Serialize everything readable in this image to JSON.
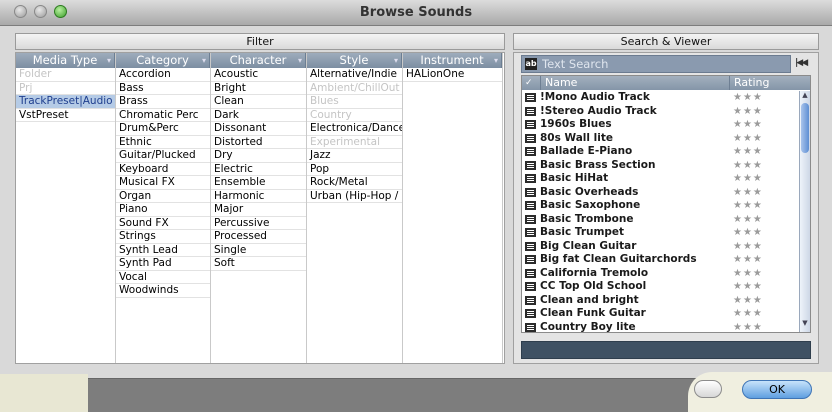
{
  "window": {
    "title": "Browse Sounds"
  },
  "filter": {
    "title": "Filter",
    "columns": [
      {
        "header": "Media Type",
        "items": [
          {
            "label": "Folder",
            "state": "dim"
          },
          {
            "label": "Prj",
            "state": "dim"
          },
          {
            "label": "TrackPreset|Audio",
            "state": "selected"
          },
          {
            "label": "VstPreset",
            "state": "normal"
          }
        ]
      },
      {
        "header": "Category",
        "items": [
          {
            "label": "Accordion"
          },
          {
            "label": "Bass"
          },
          {
            "label": "Brass"
          },
          {
            "label": "Chromatic Perc"
          },
          {
            "label": "Drum&Perc"
          },
          {
            "label": "Ethnic"
          },
          {
            "label": "Guitar/Plucked"
          },
          {
            "label": "Keyboard"
          },
          {
            "label": "Musical FX"
          },
          {
            "label": "Organ"
          },
          {
            "label": "Piano"
          },
          {
            "label": "Sound FX"
          },
          {
            "label": "Strings"
          },
          {
            "label": "Synth Lead"
          },
          {
            "label": "Synth Pad"
          },
          {
            "label": "Vocal"
          },
          {
            "label": "Woodwinds"
          }
        ]
      },
      {
        "header": "Character",
        "items": [
          {
            "label": "Acoustic"
          },
          {
            "label": "Bright"
          },
          {
            "label": "Clean"
          },
          {
            "label": "Dark"
          },
          {
            "label": "Dissonant"
          },
          {
            "label": "Distorted"
          },
          {
            "label": "Dry"
          },
          {
            "label": "Electric"
          },
          {
            "label": "Ensemble"
          },
          {
            "label": "Harmonic"
          },
          {
            "label": "Major"
          },
          {
            "label": "Percussive"
          },
          {
            "label": "Processed"
          },
          {
            "label": "Single"
          },
          {
            "label": "Soft"
          }
        ]
      },
      {
        "header": "Style",
        "items": [
          {
            "label": "Alternative/Indie",
            "state": "normal"
          },
          {
            "label": "Ambient/ChillOut",
            "state": "dim"
          },
          {
            "label": "Blues",
            "state": "dim"
          },
          {
            "label": "Country",
            "state": "dim"
          },
          {
            "label": "Electronica/Dance",
            "state": "normal"
          },
          {
            "label": "Experimental",
            "state": "dim"
          },
          {
            "label": "Jazz",
            "state": "normal"
          },
          {
            "label": "Pop",
            "state": "normal"
          },
          {
            "label": "Rock/Metal",
            "state": "normal"
          },
          {
            "label": "Urban (Hip-Hop /",
            "state": "normal"
          }
        ]
      },
      {
        "header": "Instrument",
        "items": [
          {
            "label": "HALionOne"
          }
        ]
      }
    ]
  },
  "search_viewer": {
    "title": "Search & Viewer",
    "search_placeholder": "Text Search",
    "search_icon_glyph": "ab",
    "skip_start_glyph": "|◀◀",
    "columns": {
      "check": "✓",
      "name": "Name",
      "rating": "Rating"
    },
    "rows": [
      {
        "name": "!Mono Audio Track",
        "rating": "★★★"
      },
      {
        "name": "!Stereo Audio Track",
        "rating": "★★★"
      },
      {
        "name": "1960s Blues",
        "rating": "★★★"
      },
      {
        "name": "80s Wall lite",
        "rating": "★★★"
      },
      {
        "name": "Ballade E-Piano",
        "rating": "★★★"
      },
      {
        "name": "Basic Brass Section",
        "rating": "★★★"
      },
      {
        "name": "Basic HiHat",
        "rating": "★★★"
      },
      {
        "name": "Basic Overheads",
        "rating": "★★★"
      },
      {
        "name": "Basic Saxophone",
        "rating": "★★★"
      },
      {
        "name": "Basic Trombone",
        "rating": "★★★"
      },
      {
        "name": "Basic Trumpet",
        "rating": "★★★"
      },
      {
        "name": "Big Clean Guitar",
        "rating": "★★★"
      },
      {
        "name": "Big fat Clean Guitarchords",
        "rating": "★★★"
      },
      {
        "name": "California Tremolo",
        "rating": "★★★"
      },
      {
        "name": "CC Top Old School",
        "rating": "★★★"
      },
      {
        "name": "Clean and bright",
        "rating": "★★★"
      },
      {
        "name": "Clean Funk Guitar",
        "rating": "★★★"
      },
      {
        "name": "Country Boy lite",
        "rating": "★★★"
      }
    ]
  },
  "footer": {
    "ok_label": "OK",
    "cancel_label": ""
  }
}
